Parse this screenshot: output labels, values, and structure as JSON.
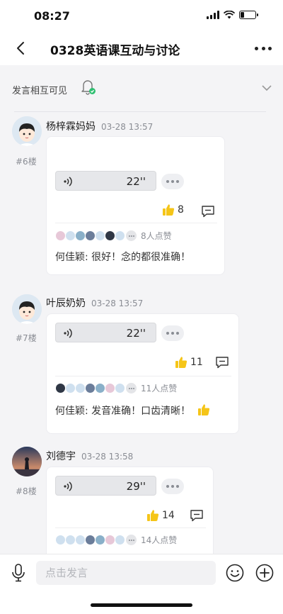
{
  "status": {
    "time": "08:27",
    "battery_level": 0.25
  },
  "header": {
    "title": "0328英语课互动与讨论",
    "back_icon": "chevron-left-icon",
    "more_icon": "more-horizontal-icon"
  },
  "visibility": {
    "label": "发言相互可见",
    "bell_icon": "bell-check-icon",
    "expand_icon": "chevron-down-icon"
  },
  "posts": [
    {
      "author": "杨梓霖妈妈",
      "time": "03-28 13:57",
      "floor": "#6楼",
      "voice_duration": "22''",
      "likes": "8",
      "likers_text": "8人点赞",
      "reply_name": "何佳颖:",
      "reply_text": " 很好！念的都很准确！",
      "reply_emoji": ""
    },
    {
      "author": "叶辰奶奶",
      "time": "03-28 13:57",
      "floor": "#7楼",
      "voice_duration": "22''",
      "likes": "11",
      "likers_text": "11人点赞",
      "reply_name": "何佳颖:",
      "reply_text": " 发音准确！口齿清晰！",
      "reply_emoji": "👍"
    },
    {
      "author": "刘德宇",
      "time": "03-28 13:58",
      "floor": "#8楼",
      "voice_duration": "29''",
      "likes": "14",
      "likers_text": "14人点赞",
      "reply_name": "",
      "reply_text": "",
      "reply_emoji": ""
    }
  ],
  "composer": {
    "placeholder": "点击发言",
    "mic_icon": "microphone-icon",
    "emoji_icon": "smiley-icon",
    "add_icon": "plus-circle-icon"
  },
  "colors": {
    "like_yellow": "#f5c518",
    "accent_green": "#2fbf71"
  }
}
